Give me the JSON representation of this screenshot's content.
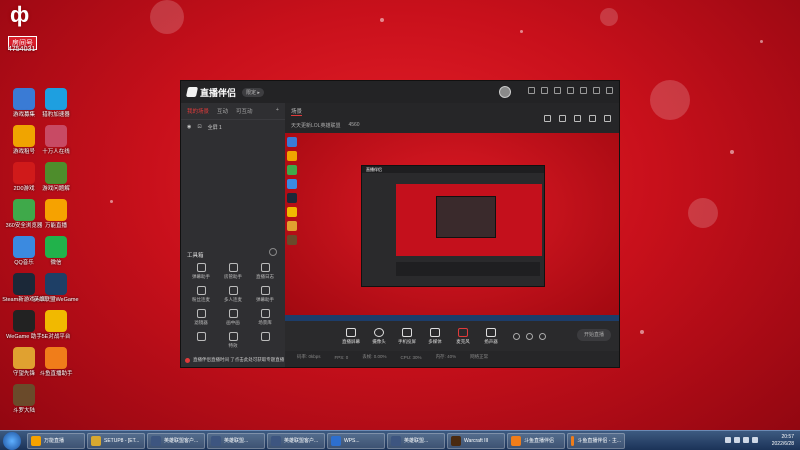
{
  "desktop": {
    "room": {
      "big_char": "ф",
      "tag": "房间号",
      "number": "4754031"
    },
    "icons": [
      {
        "label": "游戏募集",
        "color": "#3a7bd5"
      },
      {
        "label": "猎豹加速器",
        "color": "#1e9fe0"
      },
      {
        "label": "游戏租号",
        "color": "#f0a400"
      },
      {
        "label": "十万人在线",
        "color": "#c84a64"
      },
      {
        "label": "2D0游戏",
        "color": "#d01a1a"
      },
      {
        "label": "游戏问题解",
        "color": "#4e8d2c"
      },
      {
        "label": "360安全浏览器",
        "color": "#3fa94a"
      },
      {
        "label": "万能直播",
        "color": "#f6a200"
      },
      {
        "label": "QQ音乐",
        "color": "#3b8ae0"
      },
      {
        "label": "微信",
        "color": "#21b24b"
      },
      {
        "label": "Steam新游戏入口",
        "color": "#1b2838"
      },
      {
        "label": "英雄联盟WeGame",
        "color": "#1e3f66"
      },
      {
        "label": "WeGame 助手",
        "color": "#222222"
      },
      {
        "label": "5E对战平台",
        "color": "#f1b900"
      },
      {
        "label": "守望先锋",
        "color": "#e0a130"
      },
      {
        "label": "斗鱼直播助手",
        "color": "#f07d1a"
      },
      {
        "label": "斗罗大陆",
        "color": "#6a4a2a"
      }
    ]
  },
  "app": {
    "name": "直播伴侣",
    "version": "限定 ▸",
    "left_tabs": [
      "我的场景",
      "互动",
      "可互动"
    ],
    "scene_label": "全屏 1",
    "tools_label": "工具箱",
    "tools": [
      "弹幕助手",
      "房管助手",
      "直播日志",
      "粉丝连麦",
      "多人连麦",
      "弹幕助手",
      "滤镜器",
      "画中画",
      "场景库",
      "",
      "特效",
      ""
    ],
    "notice": "直播伴侣直播时间 了点击此处可获取专题直播",
    "sub_tab": "场景",
    "stream_info": [
      "天天更新LOL英雄联盟",
      "4560"
    ],
    "controls": [
      "直播屏幕",
      "摄像头",
      "手机投屏",
      "多媒体",
      "麦克风",
      "扬声器"
    ],
    "start_label": "开始直播",
    "status_items": [
      "码率: 0kbps",
      "FPS: 0",
      "丢帧: 0.00%",
      "CPU: 30%",
      "内存: 40%",
      "网络正常"
    ]
  },
  "taskbar": {
    "items": [
      {
        "label": "万能直播",
        "color": "#f6a200"
      },
      {
        "label": "SETUP8 - [ET...",
        "color": "#d8a830"
      },
      {
        "label": "英雄联盟客户...",
        "color": "#3d5580"
      },
      {
        "label": "英雄联盟...",
        "color": "#3d5580"
      },
      {
        "label": "英雄联盟客户...",
        "color": "#3d5580"
      },
      {
        "label": "WPS...",
        "color": "#2d6fcf"
      },
      {
        "label": "英雄联盟...",
        "color": "#3d5580"
      },
      {
        "label": "Warcraft III",
        "color": "#4a2a10"
      },
      {
        "label": "斗鱼直播伴侣",
        "color": "#f07d1a"
      },
      {
        "label": "斗鱼直播伴侣 - 主...",
        "color": "#f07d1a"
      }
    ],
    "time": "20:57",
    "date": "2022/6/28"
  }
}
